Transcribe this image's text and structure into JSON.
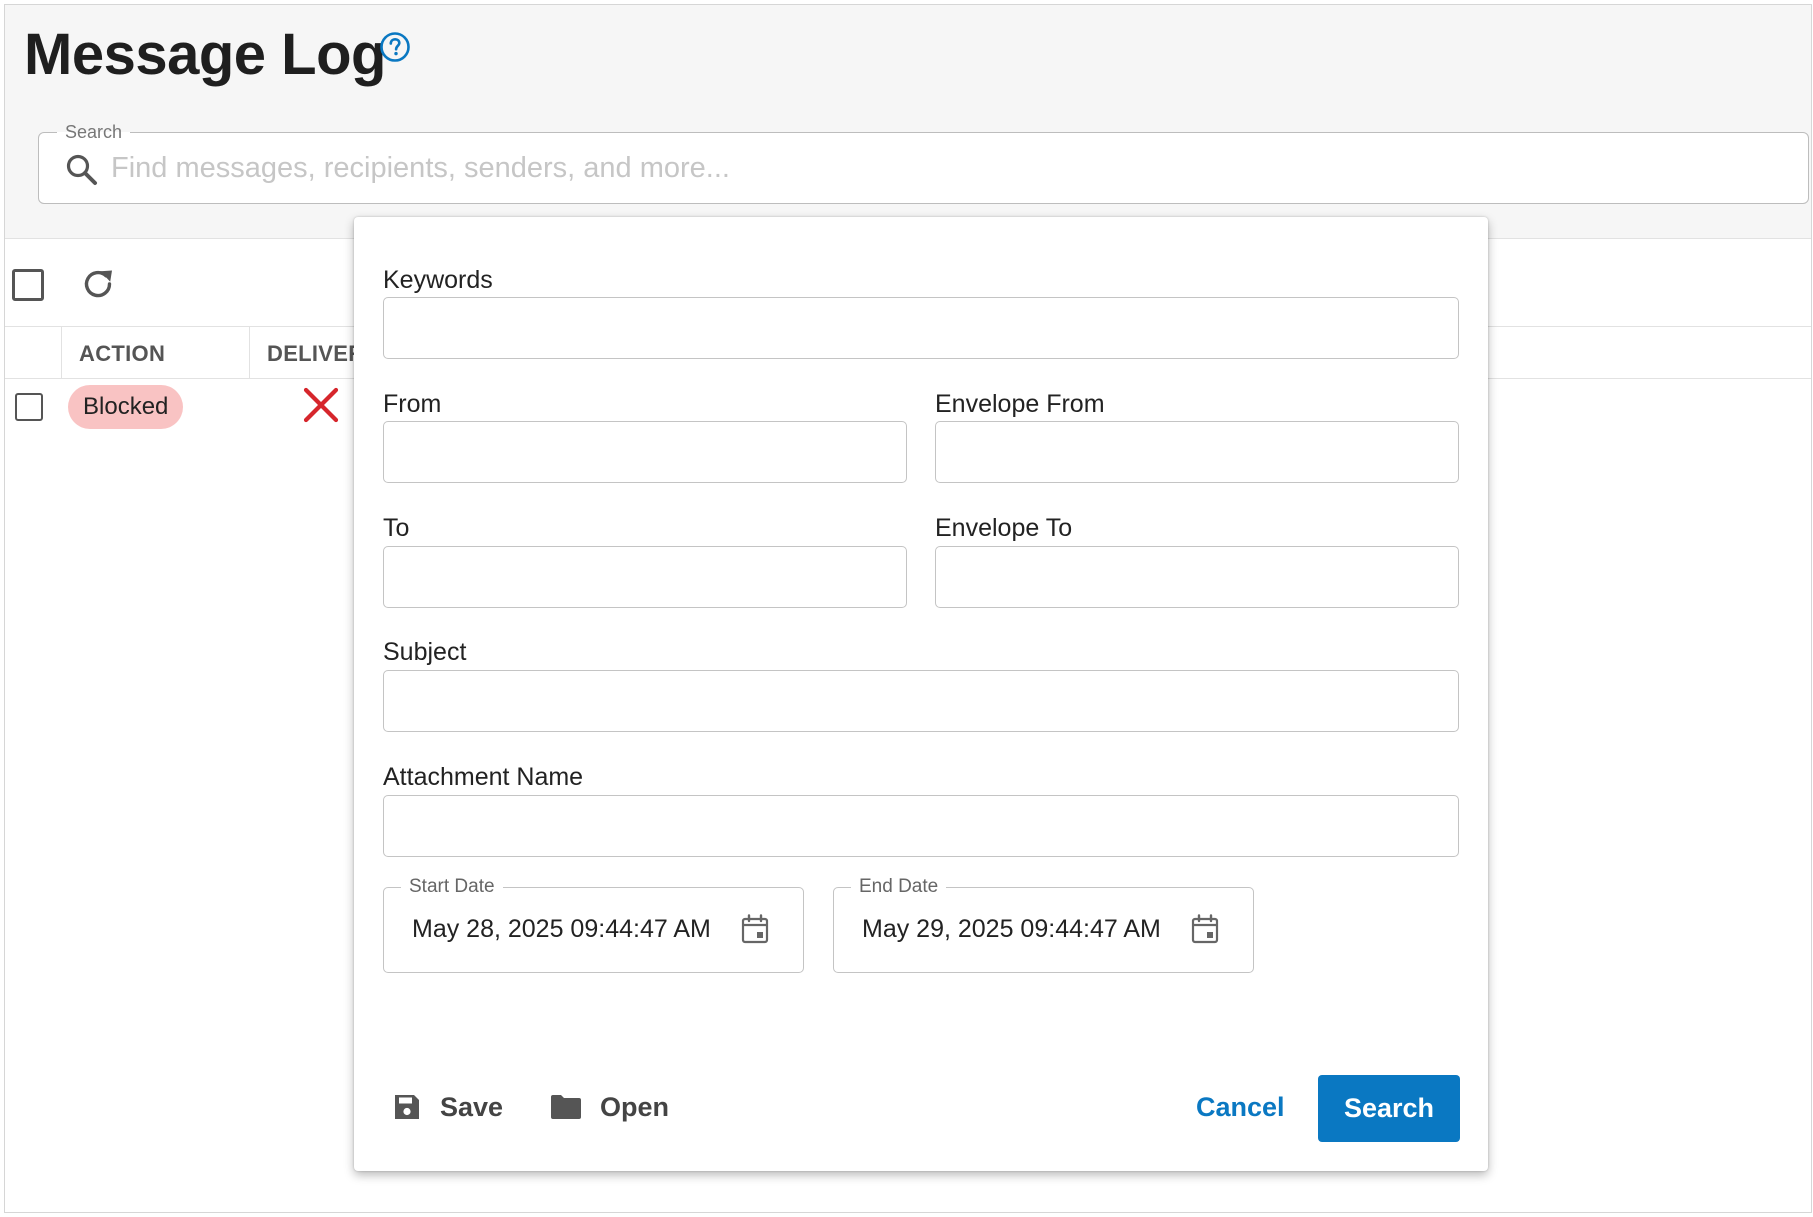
{
  "page": {
    "title": "Message Log",
    "help_icon": "help-circle-icon"
  },
  "search": {
    "legend": "Search",
    "placeholder": "Find messages, recipients, senders, and more...",
    "value": ""
  },
  "toolbar": {
    "select_all_icon": "checkbox-icon",
    "refresh_icon": "refresh-icon"
  },
  "table": {
    "columns": [
      "ACTION",
      "DELIVERY"
    ],
    "visible_columns": [
      "ACTION",
      "DELIVER"
    ],
    "rows": [
      {
        "action": "Blocked",
        "delivery_icon": "x-icon",
        "action_badge_color": "#f9c3c3"
      }
    ]
  },
  "dialog": {
    "fields": {
      "keywords": {
        "label": "Keywords",
        "value": ""
      },
      "from": {
        "label": "From",
        "value": ""
      },
      "envelope_from": {
        "label": "Envelope From",
        "value": ""
      },
      "to": {
        "label": "To",
        "value": ""
      },
      "envelope_to": {
        "label": "Envelope To",
        "value": ""
      },
      "subject": {
        "label": "Subject",
        "value": ""
      },
      "attachment_name": {
        "label": "Attachment Name",
        "value": ""
      }
    },
    "start_date": {
      "label": "Start Date",
      "value": "May 28, 2025 09:44:47 AM"
    },
    "end_date": {
      "label": "End Date",
      "value": "May 29, 2025 09:44:47 AM"
    },
    "buttons": {
      "save": "Save",
      "open": "Open",
      "cancel": "Cancel",
      "search": "Search"
    }
  },
  "colors": {
    "accent": "#0a78c2",
    "blocked_badge": "#f9c3c3",
    "error_x": "#d6262c",
    "header_bg": "#f6f6f6"
  }
}
